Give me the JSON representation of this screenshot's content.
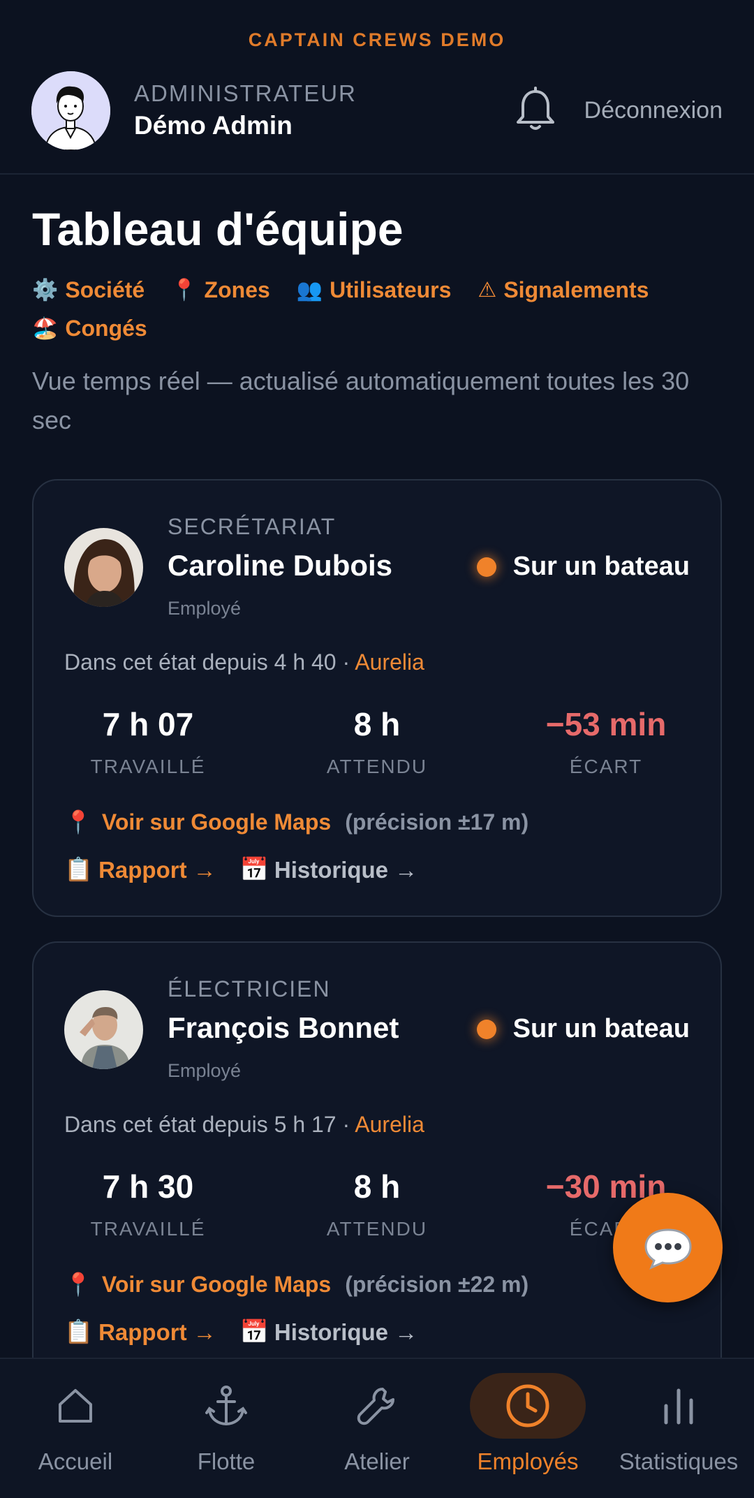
{
  "app": {
    "label": "CAPTAIN CREWS DEMO"
  },
  "header": {
    "role": "ADMINISTRATEUR",
    "name": "Démo Admin",
    "logout": "Déconnexion",
    "bell_icon": "bell-icon"
  },
  "page": {
    "title": "Tableau d'équipe",
    "subtitle": "Vue temps réel — actualisé automatiquement toutes les 30 sec",
    "links": [
      {
        "icon": "⚙️",
        "label": "Société"
      },
      {
        "icon": "📍",
        "label": "Zones"
      },
      {
        "icon": "👥",
        "label": "Utilisateurs"
      },
      {
        "icon": "⚠",
        "label": "Signalements"
      },
      {
        "icon": "🏖️",
        "label": "Congés"
      }
    ]
  },
  "employees": [
    {
      "job": "SECRÉTARIAT",
      "name": "Caroline Dubois",
      "role": "Employé",
      "status": "Sur un bateau",
      "since": "Dans cet état depuis 4 h 40 · ",
      "boat": "Aurelia",
      "worked": "7 h 07",
      "worked_label": "TRAVAILLÉ",
      "expected": "8 h",
      "expected_label": "ATTENDU",
      "gap": "−53 min",
      "gap_label": "ÉCART",
      "maps_icon": "📍",
      "maps_link": "Voir sur Google Maps",
      "precision": "(précision ±17 m)",
      "report_icon": "📋",
      "report": "Rapport →",
      "history_icon": "📅",
      "history": "Historique →"
    },
    {
      "job": "ÉLECTRICIEN",
      "name": "François Bonnet",
      "role": "Employé",
      "status": "Sur un bateau",
      "since": "Dans cet état depuis 5 h 17 · ",
      "boat": "Aurelia",
      "worked": "7 h 30",
      "worked_label": "TRAVAILLÉ",
      "expected": "8 h",
      "expected_label": "ATTENDU",
      "gap": "−30 min",
      "gap_label": "ÉCART",
      "maps_icon": "📍",
      "maps_link": "Voir sur Google Maps",
      "precision": "(précision ±22 m)",
      "report_icon": "📋",
      "report": "Rapport →",
      "history_icon": "📅",
      "history": "Historique →"
    }
  ],
  "fab": {
    "icon": "💬"
  },
  "bottom_nav": [
    {
      "label": "Accueil",
      "icon": "home-icon"
    },
    {
      "label": "Flotte",
      "icon": "anchor-icon"
    },
    {
      "label": "Atelier",
      "icon": "wrench-icon"
    },
    {
      "label": "Employés",
      "icon": "clock-icon",
      "active": true
    },
    {
      "label": "Statistiques",
      "icon": "bar-chart-icon"
    }
  ],
  "colors": {
    "background": "#0c1220",
    "accent": "#f0822a",
    "negative": "#e66a6a"
  }
}
